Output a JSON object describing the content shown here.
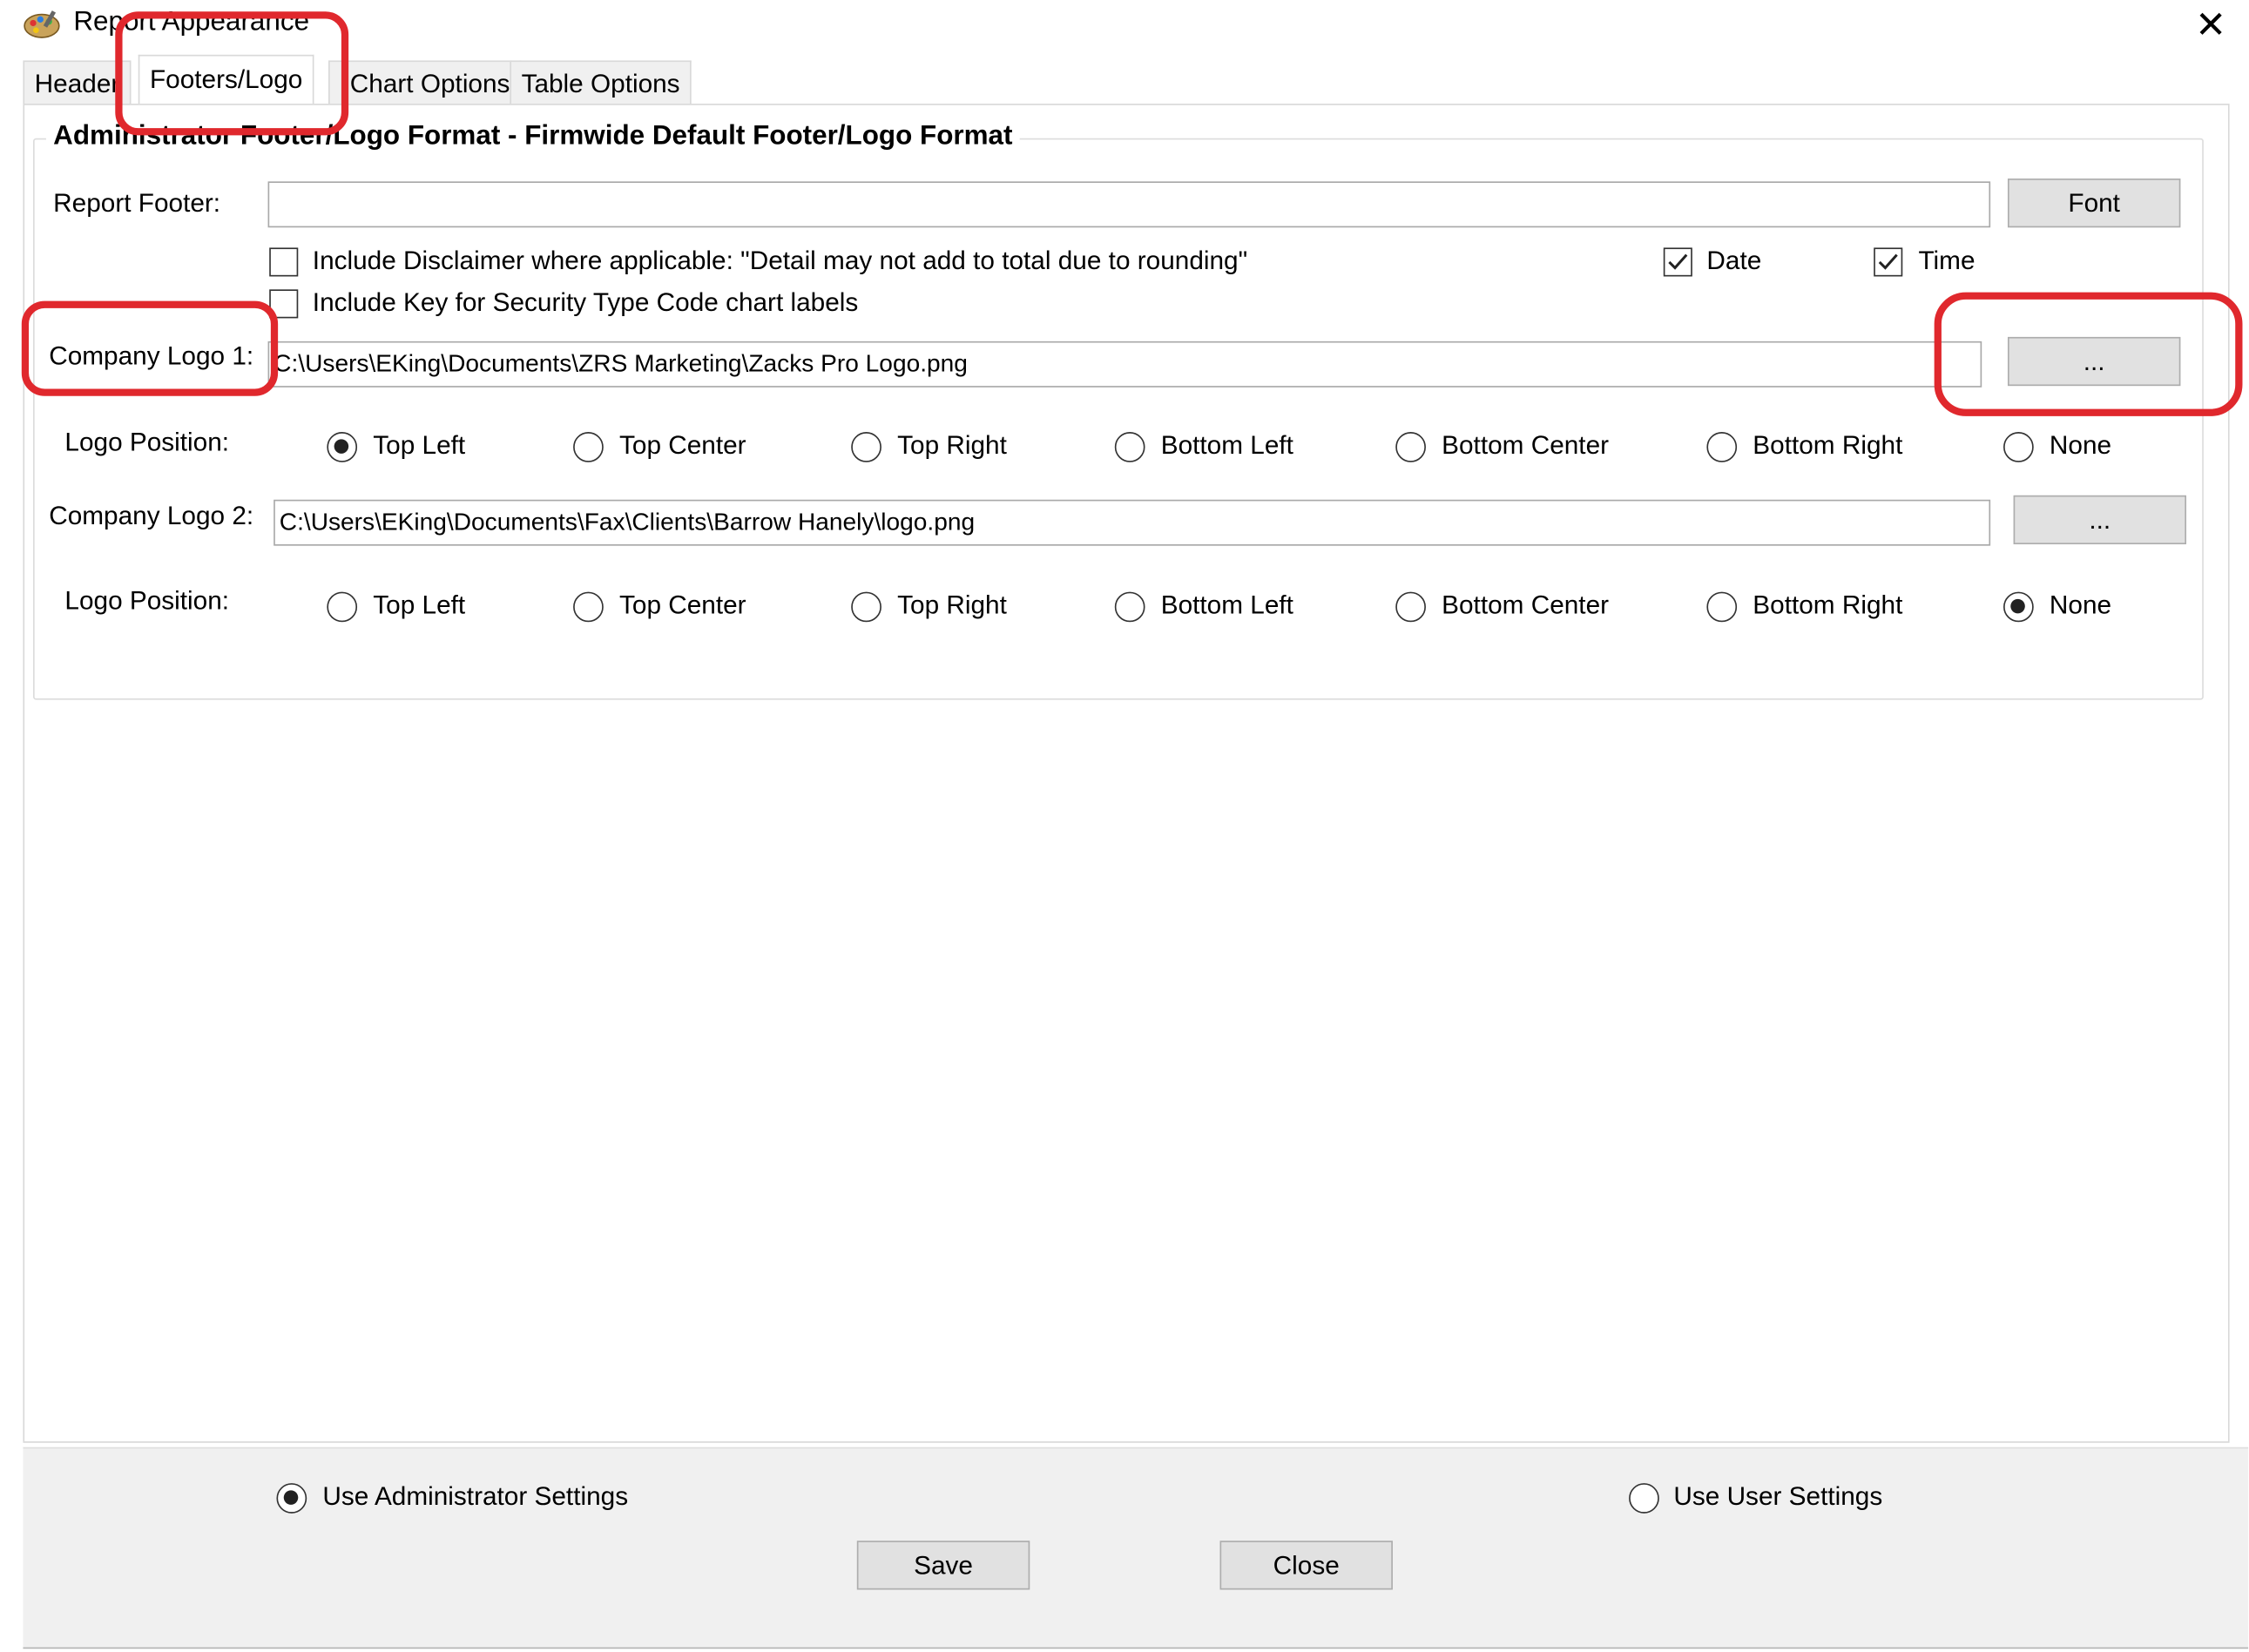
{
  "window": {
    "title": "Report Appearance",
    "close_glyph": "✕",
    "app_icon": "palette-icon"
  },
  "tabs": [
    {
      "label": "Header"
    },
    {
      "label": "Footers/Logo",
      "active": true
    },
    {
      "label": "Chart Options"
    },
    {
      "label": "Table Options"
    }
  ],
  "group": {
    "title": "Administrator Footer/Logo Format - Firmwide Default Footer/Logo  Format"
  },
  "footer": {
    "label": "Report Footer:",
    "value": "",
    "font_button": "Font"
  },
  "checkboxes": {
    "disclaimer": {
      "label": "Include Disclaimer where applicable: \"Detail may not add to total due to rounding\"",
      "checked": false
    },
    "key": {
      "label": "Include Key for Security Type Code chart labels",
      "checked": false
    },
    "date": {
      "label": "Date",
      "checked": true
    },
    "time": {
      "label": "Time",
      "checked": true
    }
  },
  "logo1": {
    "label": "Company Logo 1:",
    "path": "C:\\Users\\EKing\\Documents\\ZRS Marketing\\Zacks Pro Logo.png",
    "browse_label": "...",
    "position_label": "Logo Position:",
    "selected": "Top Left"
  },
  "logo2": {
    "label": "Company Logo 2:",
    "path": "C:\\Users\\EKing\\Documents\\Fax\\Clients\\Barrow Hanely\\logo.png",
    "browse_label": "...",
    "position_label": "Logo Position:",
    "selected": "None"
  },
  "positions": [
    "Top Left",
    "Top Center",
    "Top Right",
    "Bottom Left",
    "Bottom Center",
    "Bottom Right",
    "None"
  ],
  "settings": {
    "admin_label": "Use Administrator Settings",
    "user_label": "Use User Settings",
    "selected": "admin"
  },
  "actions": {
    "save": "Save",
    "close": "Close"
  },
  "colors": {
    "highlight": "#e0282d",
    "panel": "#f0f0f0"
  }
}
